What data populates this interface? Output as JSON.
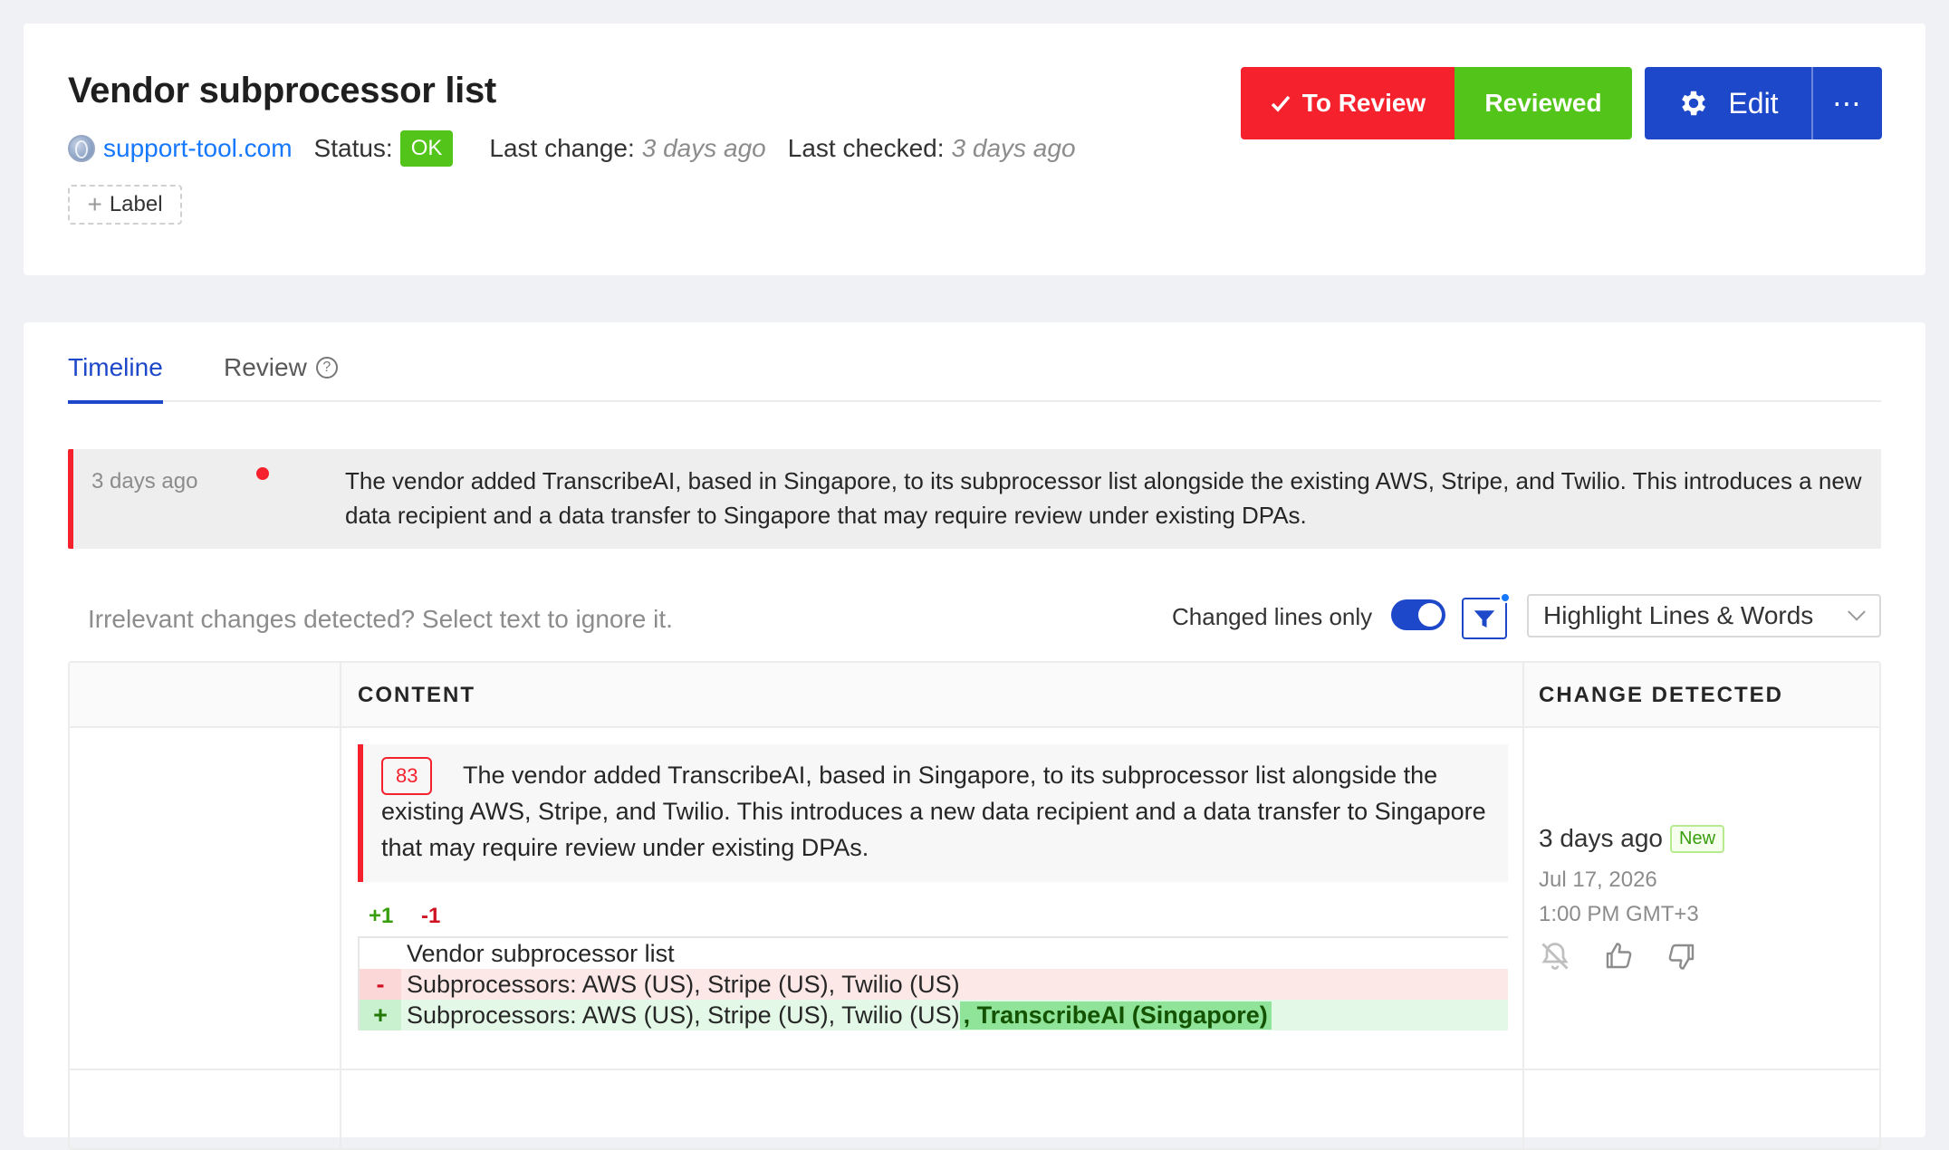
{
  "header": {
    "title": "Vendor subprocessor list",
    "site": "support-tool.com",
    "status_label": "Status:",
    "status_value": "OK",
    "last_change_label": "Last change:",
    "last_change_value": "3 days ago",
    "last_checked_label": "Last checked:",
    "last_checked_value": "3 days ago",
    "label_button": "Label",
    "to_review_button": "To Review",
    "reviewed_button": "Reviewed",
    "edit_button": "Edit",
    "more_button": "⋯"
  },
  "tabs": [
    {
      "label": "Timeline",
      "active": true
    },
    {
      "label": "Review",
      "active": false
    }
  ],
  "summary": {
    "time": "3 days ago",
    "text": "The vendor added TranscribeAI, based in Singapore, to its subprocessor list alongside the existing AWS, Stripe, and Twilio. This introduces a new data recipient and a data transfer to Singapore that may require review under existing DPAs."
  },
  "filters": {
    "hint": "Irrelevant changes detected? Select text to ignore it.",
    "changed_lines_label": "Changed lines only",
    "changed_lines_on": true,
    "highlight_mode": "Highlight Lines & Words"
  },
  "table": {
    "columns": [
      "",
      "CONTENT",
      "CHANGE DETECTED"
    ],
    "rows": [
      {
        "line_number": "83",
        "change_text": "The vendor added TranscribeAI, based in Singapore, to its subprocessor list alongside the existing AWS, Stripe, and Twilio. This introduces a new data recipient and a data transfer to Singapore that may require review under existing DPAs.",
        "added_count": "+1",
        "removed_count": "-1",
        "diff": [
          {
            "type": "context",
            "sign": "",
            "text": "Vendor subprocessor list"
          },
          {
            "type": "removed",
            "sign": "-",
            "text": "Subprocessors: AWS (US), Stripe (US), Twilio (US)"
          },
          {
            "type": "added",
            "sign": "+",
            "text": "Subprocessors: AWS (US), Stripe (US), Twilio (US)",
            "highlight": ", TranscribeAI (Singapore)"
          }
        ],
        "detected_relative": "3 days ago",
        "new_badge": "New",
        "detected_date": "Jul 17, 2026",
        "detected_time": "1:00 PM GMT+3"
      }
    ]
  },
  "colors": {
    "accent": "#1d48c9",
    "danger": "#f5222d",
    "success": "#52c41a",
    "link": "#1677ff"
  }
}
